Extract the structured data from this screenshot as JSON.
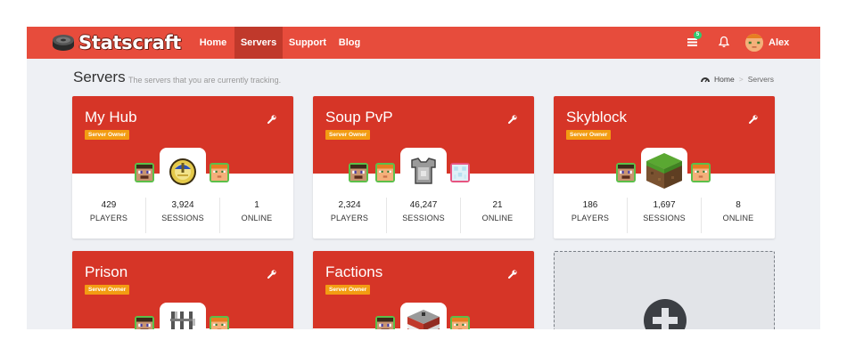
{
  "app": {
    "name": "Statscraft"
  },
  "nav": {
    "home": "Home",
    "servers": "Servers",
    "support": "Support",
    "blog": "Blog"
  },
  "user": {
    "messages_count": "5",
    "name": "Alex"
  },
  "page": {
    "title": "Servers",
    "subtitle": "The servers that you are currently tracking."
  },
  "breadcrumb": {
    "home": "Home",
    "current": "Servers"
  },
  "colors": {
    "brand": "#e74c3c",
    "card_header": "#d63527",
    "badge": "#f39c12"
  },
  "servers": [
    {
      "name": "My Hub",
      "badge": "Server Owner",
      "icon": "clock-icon",
      "stats": [
        {
          "value": "429",
          "label": "PLAYERS"
        },
        {
          "value": "3,924",
          "label": "SESSIONS"
        },
        {
          "value": "1",
          "label": "ONLINE"
        }
      ]
    },
    {
      "name": "Soup PvP",
      "badge": "Server Owner",
      "icon": "chestplate-icon",
      "stats": [
        {
          "value": "2,324",
          "label": "PLAYERS"
        },
        {
          "value": "46,247",
          "label": "SESSIONS"
        },
        {
          "value": "21",
          "label": "ONLINE"
        }
      ]
    },
    {
      "name": "Skyblock",
      "badge": "Server Owner",
      "icon": "grass-block-icon",
      "stats": [
        {
          "value": "186",
          "label": "PLAYERS"
        },
        {
          "value": "1,697",
          "label": "SESSIONS"
        },
        {
          "value": "8",
          "label": "ONLINE"
        }
      ]
    },
    {
      "name": "Prison",
      "badge": "Server Owner",
      "icon": "iron-bars-icon"
    },
    {
      "name": "Factions",
      "badge": "Server Owner",
      "icon": "tnt-icon"
    }
  ]
}
